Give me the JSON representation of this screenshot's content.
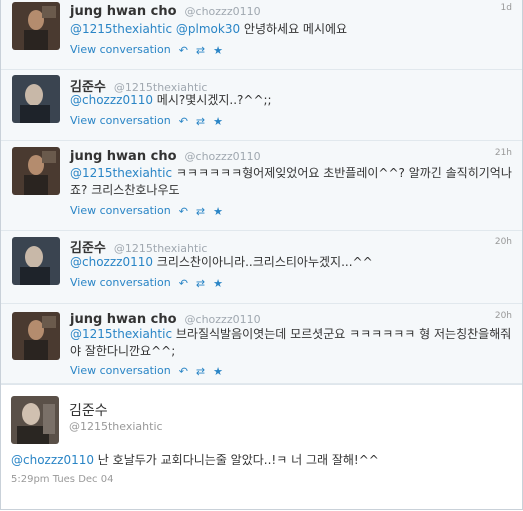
{
  "tweets": [
    {
      "name": "jung hwan cho",
      "handle": "@chozzz0110",
      "time": "1d",
      "reply_to": "@1215thexiahtic",
      "mention2": "@plmok30",
      "text": " 안녕하세요 메시에요",
      "link": "View conversation"
    },
    {
      "name": "김준수",
      "handle": "@1215thexiahtic",
      "time": "",
      "reply_to": "@chozzz0110",
      "mention2": "",
      "text": " 메시?몇시겠지..?^^;;",
      "link": "View conversation"
    },
    {
      "name": "jung hwan cho",
      "handle": "@chozzz0110",
      "time": "21h",
      "reply_to": "@1215thexiahtic",
      "mention2": "",
      "text": " ㅋㅋㅋㅋㅋㅋ형어제잊었어요 초반플레이^^? 알까긴 솔직히기억나죠? 크리스찬호나우도",
      "link": "View conversation"
    },
    {
      "name": "김준수",
      "handle": "@1215thexiahtic",
      "time": "20h",
      "reply_to": "@chozzz0110",
      "mention2": "",
      "text": " 크리스찬이아니라..크리스티아누겠지...^^",
      "link": "View conversation"
    },
    {
      "name": "jung hwan cho",
      "handle": "@chozzz0110",
      "time": "20h",
      "reply_to": "@1215thexiahtic",
      "mention2": "",
      "text": " 브라질식발음이엿는데 모르셧군요 ㅋㅋㅋㅋㅋㅋ 형 저는칭찬을해줘야 잘한다니깐요^^;",
      "link": "View conversation"
    }
  ],
  "icons": {
    "reply": "reply-icon",
    "retweet": "retweet-icon",
    "favorite": "star-icon"
  },
  "focused": {
    "name": "김준수",
    "handle": "@1215thexiahtic",
    "reply_to": "@chozzz0110",
    "text": " 난 호날두가 교회다니는줄 알았다..!ㅋ 너 그래 잘해!^^",
    "timestamp": "5:29pm Tues Dec 04"
  },
  "colors": {
    "link": "#2a85c6",
    "bg": "#f5f8fa"
  }
}
